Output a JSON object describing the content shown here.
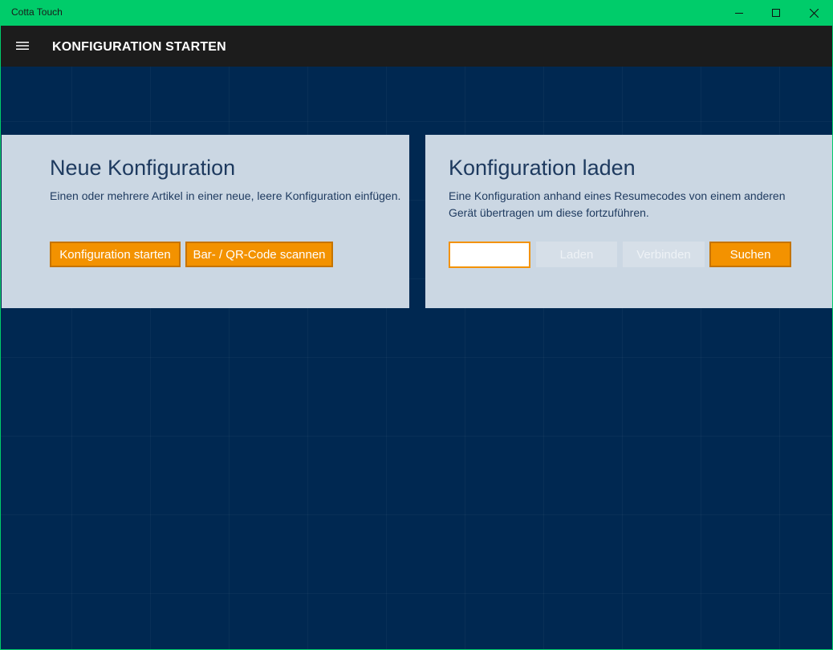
{
  "window": {
    "title": "Cotta Touch",
    "accent_color": "#00cc6a"
  },
  "appbar": {
    "title": "KONFIGURATION STARTEN",
    "menu_icon": "hamburger-icon"
  },
  "new_config": {
    "heading": "Neue Konfiguration",
    "description": "Einen oder mehrere Artikel in einer neue, leere Konfiguration einfügen.",
    "start_button": "Konfiguration starten",
    "scan_button": "Bar- / QR-Code scannen"
  },
  "load_config": {
    "heading": "Konfiguration laden",
    "description": "Eine Konfiguration anhand eines Resumecodes von einem anderen Gerät übertragen um diese fortzuführen.",
    "code_input_value": "",
    "load_button": "Laden",
    "connect_button": "Verbinden",
    "search_button": "Suchen"
  },
  "colors": {
    "button_orange": "#f39200",
    "panel_bg": "#cbd7e3",
    "content_bg": "#002851"
  }
}
